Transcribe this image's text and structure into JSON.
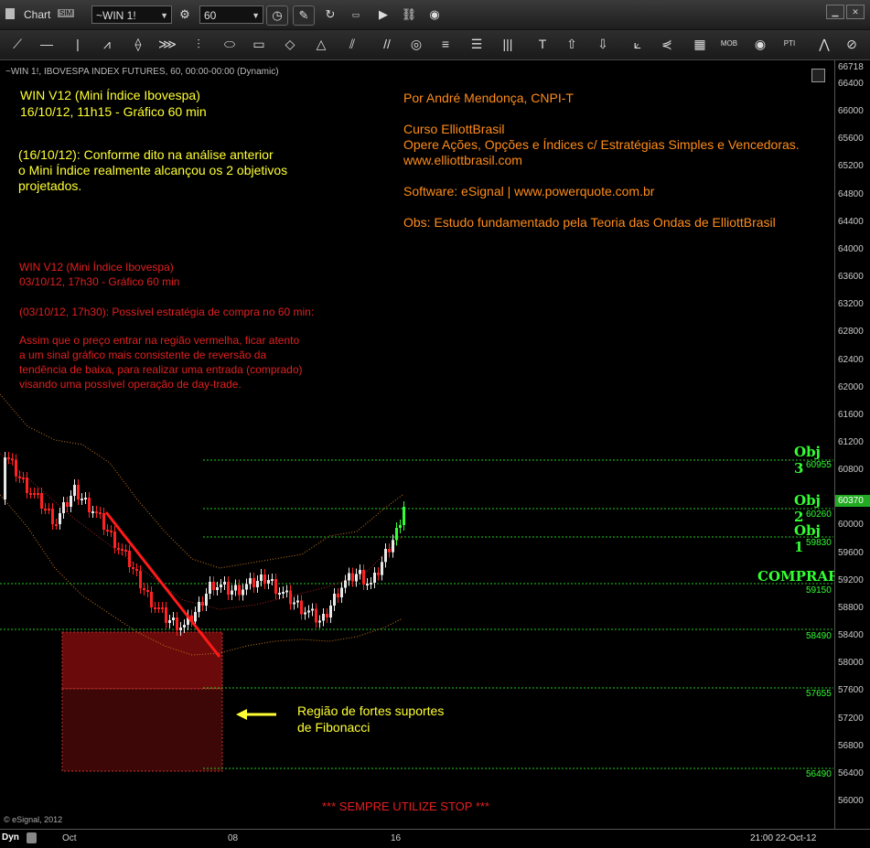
{
  "window": {
    "title": "Chart",
    "sim_badge": "SIM",
    "symbol": "~WIN 1!",
    "interval": "60"
  },
  "chart_header": "~WIN 1!, IBOVESPA INDEX FUTURES, 60, 00:00-00:00 (Dynamic)",
  "notes": {
    "title_line1": "WIN V12 (Mini Índice Ibovespa)",
    "title_line2": "16/10/12, 11h15 - Gráfico 60 min",
    "update_line1": "(16/10/12): Conforme dito na análise anterior",
    "update_line2": "o Mini Índice realmente alcançou os 2 objetivos",
    "update_line3": "projetados.",
    "author": "Por André Mendonça, CNPI-T",
    "course": "Curso ElliottBrasil",
    "course_desc": "Opere Ações, Opções e Índices c/ Estratégias Simples e Vencedoras.",
    "site": "www.elliottbrasil.com",
    "software": "Software: eSignal | www.powerquote.com.br",
    "obs": "Obs: Estudo fundamentado pela Teoria das Ondas de ElliottBrasil",
    "prev_title1": "WIN V12 (Mini Índice Ibovespa)",
    "prev_title2": "03/10/12, 17h30 - Gráfico 60 min",
    "prev_strategy": "(03/10/12, 17h30): Possível estratégia de compra no 60 min:",
    "prev_text1": "Assim que o preço entrar na região vermelha, ficar atento",
    "prev_text2": "a um sinal gráfico mais consistente de reversão da",
    "prev_text3": "tendência de baixa, para realizar uma entrada (comprado)",
    "prev_text4": "visando uma possível operação de day-trade.",
    "region_label1": "Região de fortes suportes",
    "region_label2": "de Fibonacci",
    "stop_warning": "*** SEMPRE UTILIZE STOP ***",
    "copyright": "© eSignal, 2012"
  },
  "levels": {
    "obj3_label": "Obj 3",
    "obj3_value": "60955",
    "obj2_label": "Obj 2",
    "obj2_value": "60260",
    "obj1_label": "Obj 1",
    "obj1_value": "59830",
    "buy_label": "COMPRAR",
    "buy_value": "59150",
    "l1": "58490",
    "l2": "57655",
    "l3": "56490"
  },
  "price_axis": {
    "top_value": "66718",
    "current_price": "60370",
    "ticks": [
      "66400",
      "66000",
      "65600",
      "65200",
      "64800",
      "64400",
      "64000",
      "63600",
      "63200",
      "62800",
      "62400",
      "62000",
      "61600",
      "61200",
      "60800",
      "60000",
      "59600",
      "59200",
      "58800",
      "58400",
      "58000",
      "57600",
      "57200",
      "56800",
      "56400",
      "56000"
    ]
  },
  "time_axis": {
    "mode": "Dyn",
    "labels": [
      "Oct",
      "08",
      "16"
    ],
    "cursor_time": "21:00 22-Oct-12"
  },
  "colors": {
    "notes_yellow": "#ffff33",
    "notes_orange": "#ff8c1a",
    "notes_red": "#e02020",
    "levels_green": "#33ff33",
    "trendline_red": "#ff1a1a",
    "support_zone": "#6b0a0a"
  }
}
